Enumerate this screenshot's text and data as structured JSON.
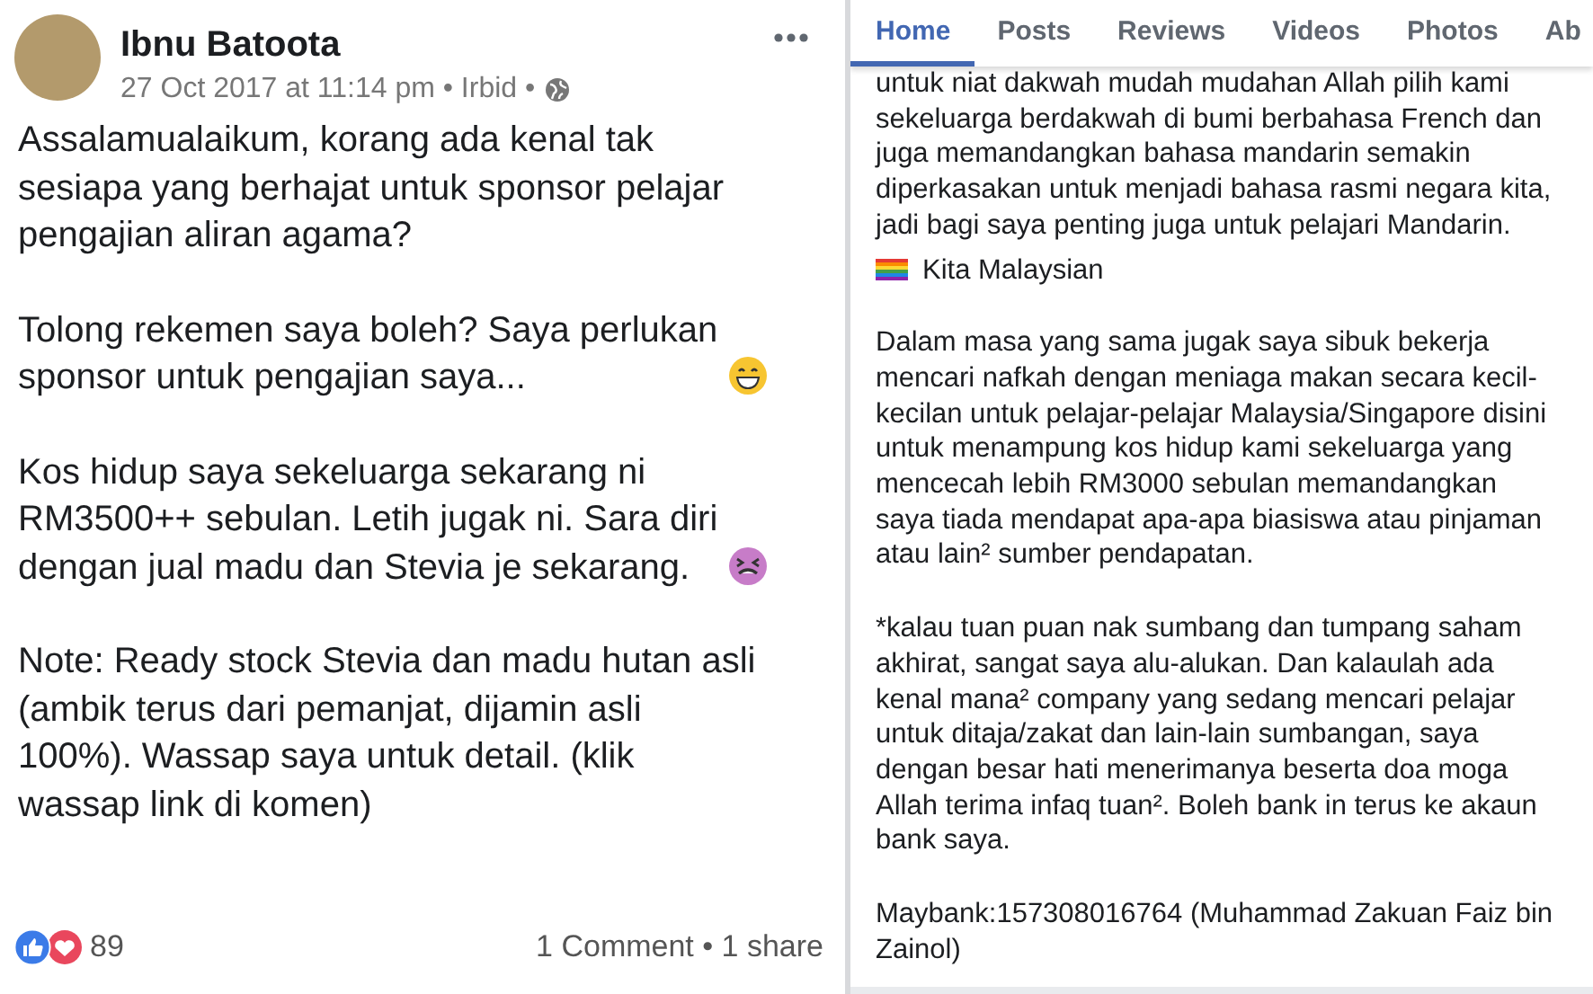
{
  "post": {
    "author": "Ibnu Batoota",
    "meta": "27 Oct 2017 at 11:14 pm • Irbid •",
    "paragraphs": [
      {
        "lines": [
          "Assalamualaikum, korang ada kenal tak",
          "sesiapa yang berhajat untuk sponsor pelajar",
          "pengajian aliran agama?"
        ],
        "kind": "plain"
      },
      {
        "lines": [
          "Tolong rekemen saya boleh? Saya perlukan",
          "sponsor untuk pengajian saya..."
        ],
        "kind": "grin"
      },
      {
        "lines": [
          "Kos hidup saya sekeluarga sekarang ni",
          "RM3500++ sebulan. Letih jugak ni. Sara diri",
          "dengan jual madu dan Stevia je sekarang."
        ],
        "kind": "tired"
      },
      {
        "lines": [
          "Note: Ready stock Stevia dan madu hutan asli",
          "(ambik terus dari pemanjat, dijamin asli",
          "100%). Wassap saya untuk detail. (klik",
          "wassap link di komen)"
        ],
        "kind": "plain"
      }
    ],
    "reaction_count": "89",
    "engagement": "1 Comment • 1 share"
  },
  "page": {
    "tabs": [
      {
        "label": "Home",
        "selected": true
      },
      {
        "label": "Posts",
        "selected": false
      },
      {
        "label": "Reviews",
        "selected": false
      },
      {
        "label": "Videos",
        "selected": false
      },
      {
        "label": "Photos",
        "selected": false
      },
      {
        "label": "Ab",
        "selected": false
      }
    ],
    "blocks": [
      {
        "kind": "text",
        "lines": [
          "untuk niat dakwah mudah mudahan Allah pilih kami",
          "sekeluarga berdakwah di bumi berbahasa French dan",
          "juga memandangkan bahasa mandarin semakin",
          "diperkasakan untuk menjadi bahasa rasmi negara kita,",
          "jadi bagi saya penting juga untuk pelajari Mandarin."
        ]
      },
      {
        "kind": "flag",
        "lines": [
          "Kita Malaysian"
        ]
      },
      {
        "kind": "text",
        "lines": [
          "Dalam masa yang sama jugak saya sibuk bekerja",
          "mencari nafkah dengan meniaga makan secara kecil-",
          "kecilan untuk pelajar-pelajar Malaysia/Singapore disini",
          "untuk menampung kos hidup kami sekeluarga yang",
          "mencecah lebih RM3000 sebulan memandangkan",
          "saya tiada mendapat apa-apa biasiswa atau pinjaman",
          "atau lain² sumber pendapatan."
        ]
      },
      {
        "kind": "text",
        "lines": [
          "*kalau tuan puan nak sumbang dan tumpang saham",
          "akhirat, sangat saya alu-alukan. Dan kalaulah ada",
          "kenal mana² company yang sedang mencari pelajar",
          "untuk ditaja/zakat dan lain-lain sumbangan, saya",
          "dengan besar hati menerimanya beserta doa moga",
          "Allah terima infaq tuan². Boleh bank in terus ke akaun",
          "bank saya."
        ]
      },
      {
        "kind": "text",
        "lines": [
          "Maybank:157308016764 (Muhammad Zakuan Faiz bin",
          "Zainol)"
        ]
      }
    ]
  }
}
